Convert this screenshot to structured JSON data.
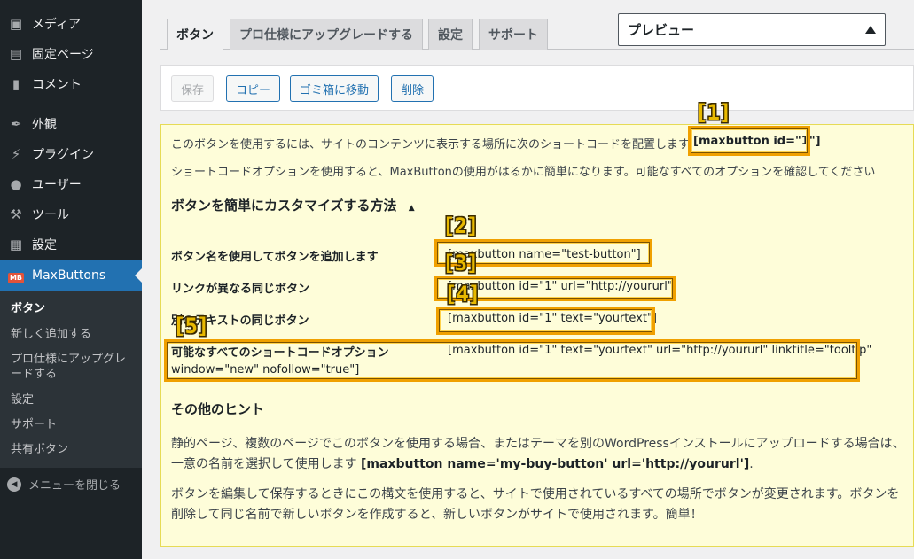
{
  "sidebar": {
    "items": [
      {
        "label": "メディア",
        "icon": "media-icon"
      },
      {
        "label": "固定ページ",
        "icon": "page-icon"
      },
      {
        "label": "コメント",
        "icon": "comment-icon"
      },
      {
        "label": "外観",
        "icon": "brush-icon"
      },
      {
        "label": "プラグイン",
        "icon": "plugin-icon"
      },
      {
        "label": "ユーザー",
        "icon": "user-icon"
      },
      {
        "label": "ツール",
        "icon": "wrench-icon"
      },
      {
        "label": "設定",
        "icon": "settings-icon"
      },
      {
        "label": "MaxButtons",
        "icon": "maxbuttons-icon"
      }
    ],
    "maxbuttons_badge": "MB",
    "submenu": [
      "ボタン",
      "新しく追加する",
      "プロ仕様にアップグレードする",
      "設定",
      "サポート",
      "共有ボタン"
    ],
    "collapse_label": "メニューを閉じる"
  },
  "tabs": [
    "ボタン",
    "プロ仕様にアップグレードする",
    "設定",
    "サポート"
  ],
  "preview": {
    "label": "プレビュー"
  },
  "actions": {
    "save": "保存",
    "copy": "コピー",
    "trash": "ゴミ箱に移動",
    "delete": "削除"
  },
  "panel": {
    "intro": "このボタンを使用するには、サイトのコンテンツに表示する場所に次のショートコードを配置します",
    "intro_code": "[maxbutton id=\"1\"]",
    "options_note": "ショートコードオプションを使用すると、MaxButtonの使用がはるかに簡単になります。可能なすべてのオプションを確認してください",
    "customize_heading": "ボタンを簡単にカスタマイズする方法",
    "rows": [
      {
        "label": "ボタン名を使用してボタンを追加します",
        "code": "[maxbutton name=\"test-button\"]"
      },
      {
        "label": "リンクが異なる同じボタン",
        "code": "[maxbutton id=\"1\" url=\"http://yoururl\"]"
      },
      {
        "label": "別のテキストの同じボタン",
        "code": "[maxbutton id=\"1\" text=\"yourtext\"]"
      },
      {
        "label": "可能なすべてのショートコードオプション",
        "code": "[maxbutton id=\"1\" text=\"yourtext\" url=\"http://yoururl\" linktitle=\"tooltip\"",
        "code2": "window=\"new\" nofollow=\"true\"]"
      }
    ],
    "tips_heading": "その他のヒント",
    "tip1_a": "静的ページ、複数のページでこのボタンを使用する場合、またはテーマを別のWordPressインストールにアップロードする場合は、一意の名前を選択して使用します ",
    "tip1_code": "[maxbutton name='my-buy-button' url='http://yoururl']",
    "tip1_end": ".",
    "tip2": "ボタンを編集して保存するときにこの構文を使用すると、サイトで使用されているすべての場所でボタンが変更されます。ボタンを削除して同じ名前で新しいボタンを作成すると、新しいボタンがサイトで使用されます。簡単！"
  },
  "markers": [
    "[1]",
    "[2]",
    "[3]",
    "[4]",
    "[5]"
  ],
  "colors": {
    "sidebar_bg": "#1d2327",
    "accent": "#2271b1",
    "notice_bg": "#fefdd9",
    "highlight": "#f0a000"
  }
}
